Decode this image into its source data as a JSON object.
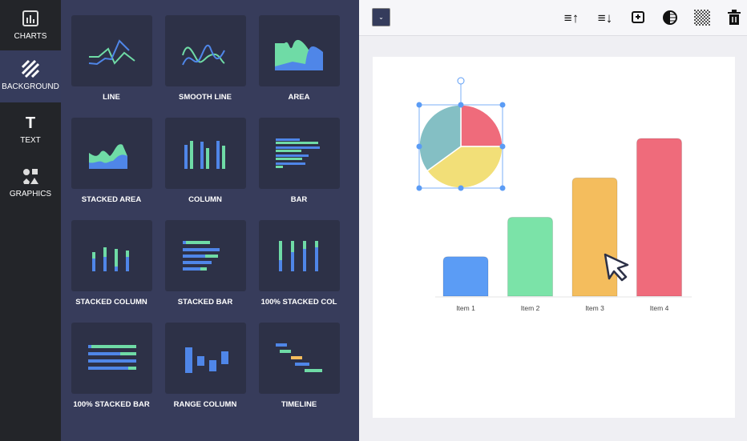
{
  "sidebar": {
    "items": [
      {
        "label": "CHARTS",
        "icon": "bar-chart-icon",
        "active": false
      },
      {
        "label": "BACKGROUND",
        "icon": "stripes-icon",
        "active": true
      },
      {
        "label": "TEXT",
        "icon": "text-icon",
        "active": false
      },
      {
        "label": "GRAPHICS",
        "icon": "shapes-icon",
        "active": false
      }
    ]
  },
  "panel": {
    "tiles": [
      {
        "label": "LINE"
      },
      {
        "label": "SMOOTH LINE"
      },
      {
        "label": "AREA"
      },
      {
        "label": "STACKED AREA"
      },
      {
        "label": "COLUMN"
      },
      {
        "label": "BAR"
      },
      {
        "label": "STACKED COLUMN"
      },
      {
        "label": "STACKED BAR"
      },
      {
        "label": "100% STACKED COL"
      },
      {
        "label": "100% STACKED BAR"
      },
      {
        "label": "RANGE COLUMN"
      },
      {
        "label": "TIMELINE"
      }
    ]
  },
  "toolbar": {
    "icons": [
      "bring-forward-icon",
      "send-backward-icon",
      "add-image-icon",
      "contrast-icon",
      "transparency-icon",
      "trash-icon"
    ]
  },
  "canvas": {
    "colors": {
      "blue": "#5b9cf5",
      "green": "#7be3a8",
      "orange": "#f4bd5d",
      "red": "#ef6b7b",
      "teal": "#84bfc4",
      "yellow": "#f2df78"
    },
    "chart_data": {
      "type": "bar",
      "categories": [
        "Item 1",
        "Item 2",
        "Item 3",
        "Item 4"
      ],
      "values": [
        1,
        2,
        3,
        4
      ],
      "ylim": [
        0,
        4
      ]
    },
    "pie_data": {
      "type": "pie",
      "values": [
        25,
        40,
        35
      ]
    }
  }
}
